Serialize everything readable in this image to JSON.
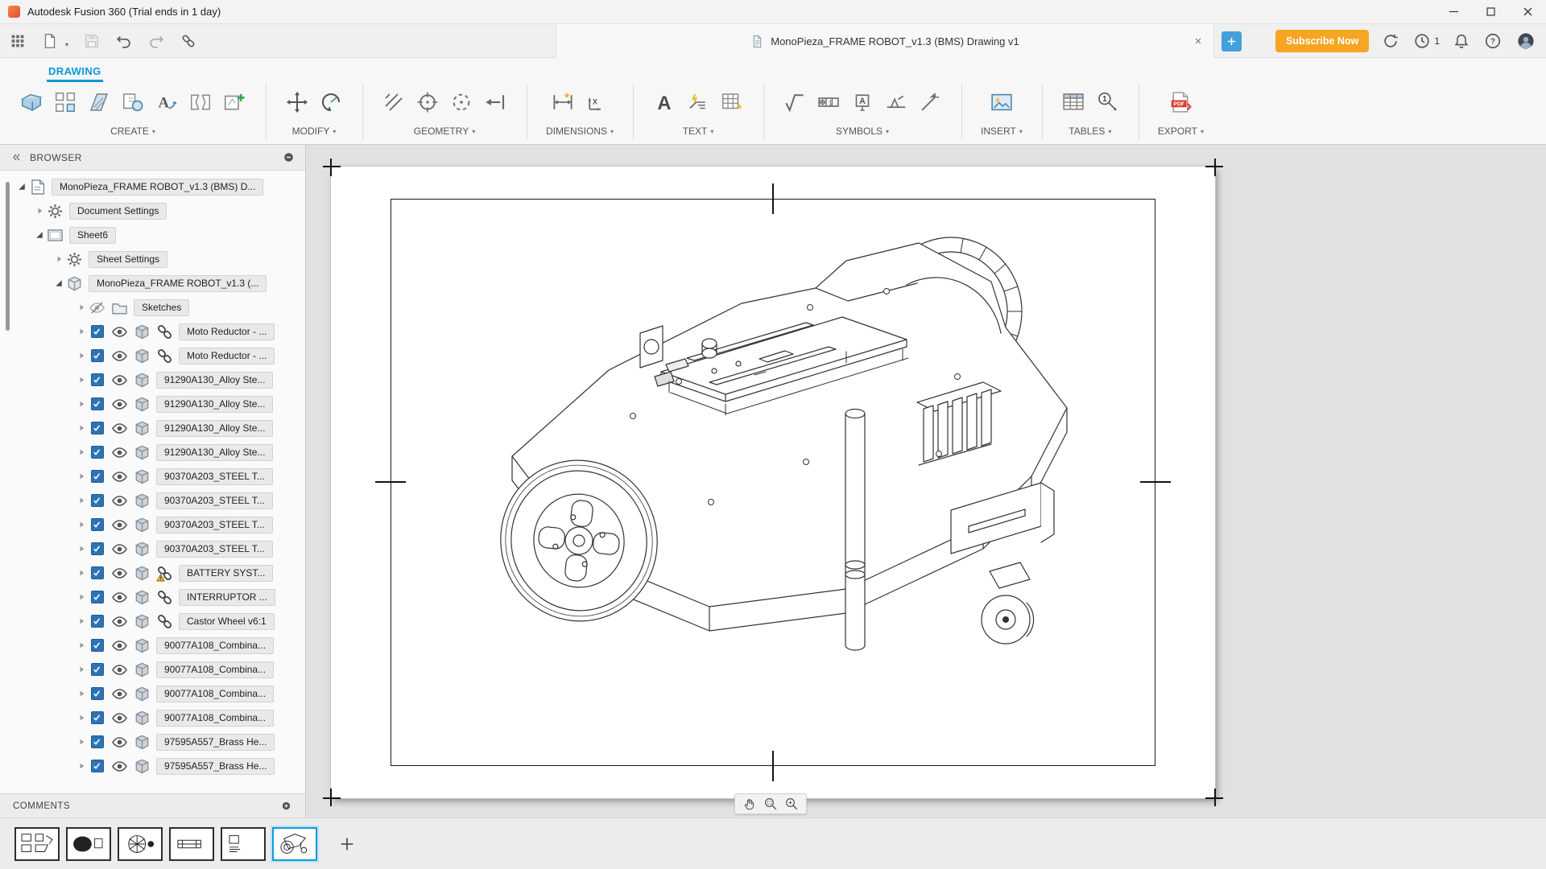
{
  "titlebar": {
    "app_title": "Autodesk Fusion 360 (Trial ends in 1 day)"
  },
  "toolbar": {
    "document_tab": "MonoPieza_FRAME ROBOT_v1.3 (BMS) Drawing v1",
    "subscribe_label": "Subscribe Now",
    "notification_count": "1"
  },
  "ribbon": {
    "workspace_tab": "DRAWING",
    "groups": [
      {
        "label": "CREATE",
        "icons": [
          "base-view",
          "projected-view",
          "section-view",
          "detail-view",
          "stamp-a",
          "break-view",
          "new-sketch"
        ]
      },
      {
        "label": "MODIFY",
        "icons": [
          "move",
          "rotate"
        ]
      },
      {
        "label": "GEOMETRY",
        "icons": [
          "hatch",
          "center-circle",
          "dashed-circle",
          "project-arrow"
        ]
      },
      {
        "label": "DIMENSIONS",
        "icons": [
          "dim-linear",
          "dim-ordinate"
        ]
      },
      {
        "label": "TEXT",
        "icons": [
          "text-a",
          "text-leader",
          "text-table"
        ]
      },
      {
        "label": "SYMBOLS",
        "icons": [
          "sym-surface",
          "sym-fcf",
          "sym-datum",
          "sym-weld",
          "sym-edge"
        ]
      },
      {
        "label": "INSERT",
        "icons": [
          "insert-image"
        ]
      },
      {
        "label": "TABLES",
        "icons": [
          "table",
          "balloon"
        ]
      },
      {
        "label": "EXPORT",
        "icons": [
          "pdf"
        ]
      }
    ]
  },
  "browser": {
    "title": "BROWSER",
    "rows": [
      {
        "label": "MonoPieza_FRAME ROBOT_v1.3 (BMS) D...",
        "depth": 0,
        "expand": "expanded",
        "icons": [
          "doc"
        ]
      },
      {
        "label": "Document Settings",
        "depth": 1,
        "expand": "collapsed",
        "icons": [
          "gear"
        ]
      },
      {
        "label": "Sheet6",
        "depth": 1,
        "expand": "expanded",
        "icons": [
          "sheet"
        ]
      },
      {
        "label": "Sheet Settings",
        "depth": 2,
        "expand": "collapsed",
        "icons": [
          "gear"
        ]
      },
      {
        "label": "MonoPieza_FRAME ROBOT_v1.3 (...",
        "depth": 2,
        "expand": "expanded",
        "icons": [
          "component"
        ]
      },
      {
        "label": "Sketches",
        "depth": 3,
        "expand": "collapsed",
        "icons": [
          "eye-off",
          "folder"
        ]
      },
      {
        "label": "Moto Reductor - ...",
        "depth": 3,
        "expand": "collapsed",
        "icons": [
          "checkbox",
          "eye",
          "body",
          "link"
        ]
      },
      {
        "label": "Moto Reductor - ...",
        "depth": 3,
        "expand": "collapsed",
        "icons": [
          "checkbox",
          "eye",
          "body",
          "link"
        ]
      },
      {
        "label": "91290A130_Alloy Ste...",
        "depth": 3,
        "expand": "collapsed",
        "icons": [
          "checkbox",
          "eye",
          "body"
        ]
      },
      {
        "label": "91290A130_Alloy Ste...",
        "depth": 3,
        "expand": "collapsed",
        "icons": [
          "checkbox",
          "eye",
          "body"
        ]
      },
      {
        "label": "91290A130_Alloy Ste...",
        "depth": 3,
        "expand": "collapsed",
        "icons": [
          "checkbox",
          "eye",
          "body"
        ]
      },
      {
        "label": "91290A130_Alloy Ste...",
        "depth": 3,
        "expand": "collapsed",
        "icons": [
          "checkbox",
          "eye",
          "body"
        ]
      },
      {
        "label": "90370A203_STEEL T...",
        "depth": 3,
        "expand": "collapsed",
        "icons": [
          "checkbox",
          "eye",
          "body"
        ]
      },
      {
        "label": "90370A203_STEEL T...",
        "depth": 3,
        "expand": "collapsed",
        "icons": [
          "checkbox",
          "eye",
          "body"
        ]
      },
      {
        "label": "90370A203_STEEL T...",
        "depth": 3,
        "expand": "collapsed",
        "icons": [
          "checkbox",
          "eye",
          "body"
        ]
      },
      {
        "label": "90370A203_STEEL T...",
        "depth": 3,
        "expand": "collapsed",
        "icons": [
          "checkbox",
          "eye",
          "body"
        ]
      },
      {
        "label": "BATTERY SYST...",
        "depth": 3,
        "expand": "collapsed",
        "icons": [
          "checkbox",
          "eye",
          "body",
          "link-warning"
        ]
      },
      {
        "label": "INTERRUPTOR ...",
        "depth": 3,
        "expand": "collapsed",
        "icons": [
          "checkbox",
          "eye",
          "body",
          "link"
        ]
      },
      {
        "label": "Castor Wheel v6:1",
        "depth": 3,
        "expand": "collapsed",
        "icons": [
          "checkbox",
          "eye",
          "body",
          "link"
        ]
      },
      {
        "label": "90077A108_Combina...",
        "depth": 3,
        "expand": "collapsed",
        "icons": [
          "checkbox",
          "eye",
          "body"
        ]
      },
      {
        "label": "90077A108_Combina...",
        "depth": 3,
        "expand": "collapsed",
        "icons": [
          "checkbox",
          "eye",
          "body"
        ]
      },
      {
        "label": "90077A108_Combina...",
        "depth": 3,
        "expand": "collapsed",
        "icons": [
          "checkbox",
          "eye",
          "body"
        ]
      },
      {
        "label": "90077A108_Combina...",
        "depth": 3,
        "expand": "collapsed",
        "icons": [
          "checkbox",
          "eye",
          "body"
        ]
      },
      {
        "label": "97595A557_Brass He...",
        "depth": 3,
        "expand": "collapsed",
        "icons": [
          "checkbox",
          "eye",
          "body"
        ]
      },
      {
        "label": "97595A557_Brass He...",
        "depth": 3,
        "expand": "collapsed",
        "icons": [
          "checkbox",
          "eye",
          "body"
        ]
      }
    ]
  },
  "comments": {
    "label": "COMMENTS"
  },
  "sheet_strip": {
    "thumbs": [
      "t1",
      "t2",
      "t3",
      "t4",
      "t5",
      "t6"
    ],
    "selected": 5
  },
  "canvas_nav": {
    "icons": [
      "pan-hand",
      "zoom-window",
      "zoom-plus"
    ]
  },
  "colors": {
    "accent": "#0a99d6",
    "subscribe": "#f6a623",
    "checkbox": "#2e74b5"
  }
}
